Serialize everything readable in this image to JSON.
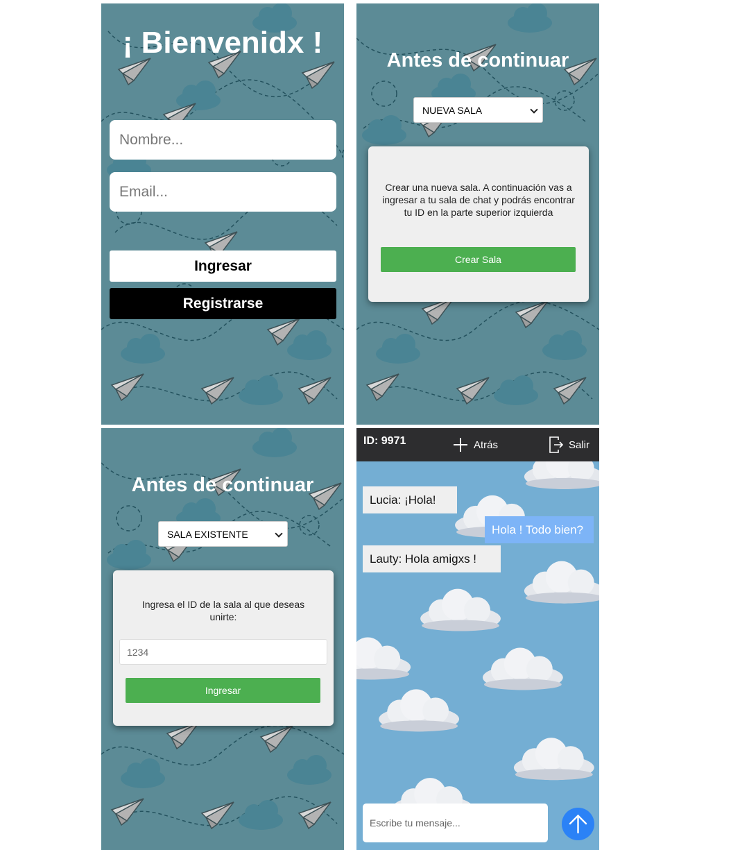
{
  "welcome": {
    "title": "¡ Bienvenidx !",
    "name_placeholder": "Nombre...",
    "email_placeholder": "Email...",
    "login_label": "Ingresar",
    "register_label": "Registrarse"
  },
  "new_room": {
    "title": "Antes de continuar",
    "select_value": "NUEVA SALA",
    "description": "Crear una nueva sala. A continuación vas a ingresar a tu sala de chat y podrás encontrar tu ID en la parte superior izquierda",
    "button_label": "Crear Sala"
  },
  "existing_room": {
    "title": "Antes de continuar",
    "select_value": "SALA EXISTENTE",
    "description": "Ingresa el ID de la sala al que deseas unirte:",
    "id_placeholder": "1234",
    "button_label": "Ingresar"
  },
  "chat": {
    "id_label": "ID: 9971",
    "back_label": "Atrás",
    "exit_label": "Salir",
    "messages": [
      {
        "text": "Lucia: ¡Hola!",
        "own": false
      },
      {
        "text": "Hola ! Todo bien?",
        "own": true
      },
      {
        "text": "Lauty: Hola amigxs !",
        "own": false
      }
    ],
    "input_placeholder": "Escribe tu mensaje..."
  },
  "colors": {
    "paper_bg": "#5c8b96",
    "sky_bg": "#74aed3",
    "accent_green": "#4caf50",
    "send_blue": "#2b82f6",
    "own_bubble": "#7db4f7",
    "header_dark": "#2d2d2f"
  }
}
